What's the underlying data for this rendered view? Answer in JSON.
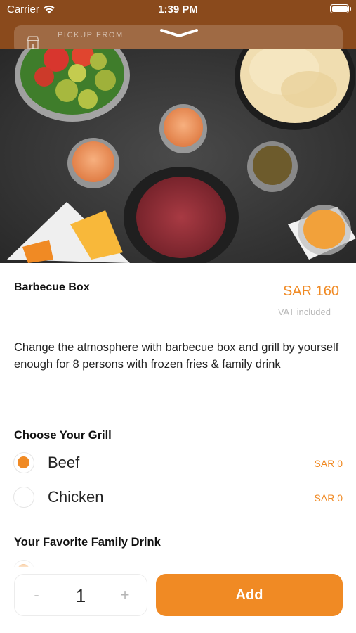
{
  "status_bar": {
    "carrier": "Carrier",
    "time": "1:39 PM",
    "icons": [
      "wifi-icon",
      "battery-icon"
    ]
  },
  "header": {
    "pickup_label": "PICKUP FROM",
    "icons": [
      "store-icon",
      "chevron-down-icon"
    ],
    "brand_color": "#8a4a1c"
  },
  "hero_image": {
    "description_icons": [
      "salad-bowl-icon",
      "fries-bowl-icon",
      "sauce-cup-icon",
      "minced-beef-icon",
      "spice-jar-icon",
      "cheese-slice-icon",
      "cheese-sauce-icon"
    ]
  },
  "product": {
    "title": "Barbecue Box",
    "price": "SAR 160",
    "vat_note": "VAT included",
    "description": "Change the atmosphere with barbecue box and grill by yourself enough for 8 persons with frozen fries & family drink"
  },
  "option_groups": [
    {
      "title": "Choose Your Grill",
      "options": [
        {
          "label": "Beef",
          "price": "SAR 0",
          "selected": true
        },
        {
          "label": "Chicken",
          "price": "SAR 0",
          "selected": false
        }
      ]
    },
    {
      "title": "Your Favorite Family Drink",
      "options": []
    }
  ],
  "footer": {
    "minus": "-",
    "quantity": "1",
    "plus": "+",
    "add_label": "Add"
  },
  "colors": {
    "accent": "#f08a24",
    "muted": "#b9b9b9"
  }
}
